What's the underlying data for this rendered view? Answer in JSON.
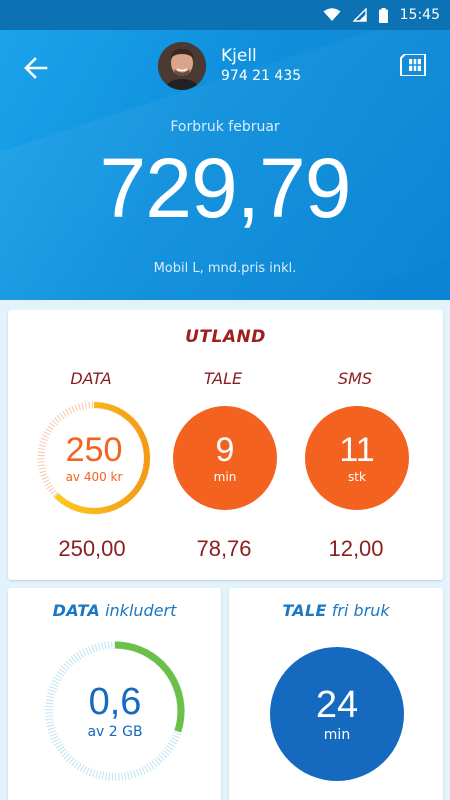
{
  "status_bar": {
    "time": "15:45",
    "icons": [
      "wifi-icon",
      "signal-icon",
      "battery-icon"
    ]
  },
  "header": {
    "back_icon": "arrow-left-icon",
    "sim_icon": "sim-card-icon",
    "user_name": "Kjell",
    "user_phone": "974 21 435"
  },
  "summary": {
    "period_label": "Forbruk februar",
    "total_amount": "729,79",
    "plan_label": "Mobil L, mnd.pris inkl."
  },
  "abroad": {
    "title": "UTLAND",
    "columns": [
      {
        "label": "DATA",
        "value_main": "250",
        "value_sub": "av 400 kr",
        "progress": 0.625,
        "amount": "250,00"
      },
      {
        "label": "TALE",
        "value_main": "9",
        "value_sub": "min",
        "amount": "78,76"
      },
      {
        "label": "SMS",
        "value_main": "11",
        "value_sub": "stk",
        "amount": "12,00"
      }
    ]
  },
  "data_included": {
    "title_brand": "DATA",
    "title_rest": "inkludert",
    "value_main": "0,6",
    "value_sub": "av 2 GB",
    "progress": 0.3
  },
  "talk_free": {
    "title_brand": "TALE",
    "title_rest": "fri bruk",
    "value_main": "24",
    "value_sub": "min"
  },
  "colors": {
    "header_blue": "#0f8fdc",
    "abroad_red": "#8a1f1f",
    "orange": "#f4621f",
    "blue_circle": "#1569bf",
    "green_progress": "#6cc04a"
  }
}
